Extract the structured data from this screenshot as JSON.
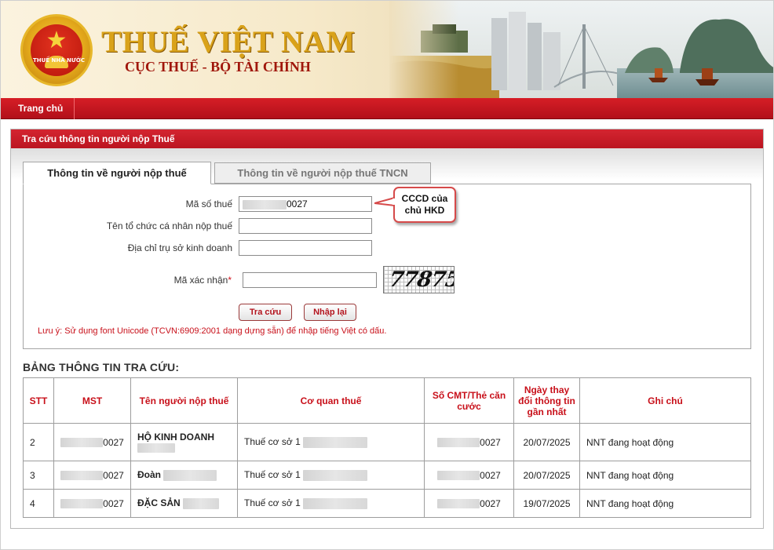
{
  "banner": {
    "emblem_text": "THUẾ NHÀ NƯỚC",
    "title": "THUẾ VIỆT NAM",
    "subtitle": "CỤC THUẾ - BỘ TÀI CHÍNH"
  },
  "nav": {
    "home": "Trang chủ"
  },
  "panel": {
    "title": "Tra cứu thông tin người nộp Thuế"
  },
  "tabs": [
    {
      "label": "Thông tin về người nộp thuế",
      "active": true
    },
    {
      "label": "Thông tin về người nộp thuế TNCN",
      "active": false
    }
  ],
  "form": {
    "mst_label": "Mã số thuế",
    "mst_value": "0027",
    "name_label": "Tên tổ chức cá nhân nộp thuế",
    "name_value": "",
    "address_label": "Địa chỉ trụ sở kinh doanh",
    "address_value": "",
    "captcha_label": "Mã xác nhận",
    "captcha_required": "*",
    "captcha_value": "",
    "captcha_text": "77875",
    "search_button": "Tra cứu",
    "reset_button": "Nhập lại",
    "note": "Lưu ý: Sử dụng font Unicode (TCVN:6909:2001 dạng dựng sẵn) để nhập tiếng Việt có dấu."
  },
  "callout": {
    "line1": "CCCD của",
    "line2": "chủ HKD"
  },
  "results": {
    "title": "BẢNG THÔNG TIN TRA CỨU:",
    "headers": {
      "stt": "STT",
      "mst": "MST",
      "name": "Tên người nộp thuế",
      "office": "Cơ quan thuế",
      "id": "Số CMT/Thẻ căn cước",
      "date": "Ngày thay đổi thông tin gần nhất",
      "note": "Ghi chú"
    },
    "rows": [
      {
        "stt": "2",
        "mst": "0027",
        "name": "HỘ KINH DOANH",
        "office": "Thuế cơ sở 1",
        "id": "0027",
        "date": "20/07/2025",
        "note": "NNT đang hoạt động"
      },
      {
        "stt": "3",
        "mst": "0027",
        "name": "Đoàn",
        "office": "Thuế cơ sở 1",
        "id": "0027",
        "date": "20/07/2025",
        "note": "NNT đang hoạt động"
      },
      {
        "stt": "4",
        "mst": "0027",
        "name": "ĐẶC SẢN",
        "office": "Thuế cơ sở 1",
        "id": "0027",
        "date": "19/07/2025",
        "note": "NNT đang hoạt động"
      }
    ]
  },
  "colors": {
    "brand_red": "#c8101a",
    "gold": "#d9a21a"
  },
  "icons": [
    "emblem-logo",
    "star-icon"
  ]
}
